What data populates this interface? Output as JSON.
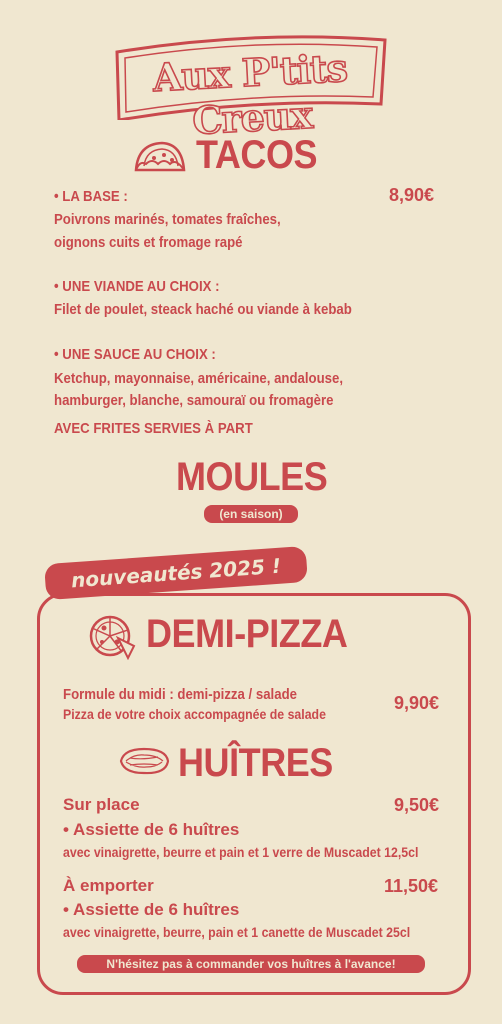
{
  "brand": {
    "name": "Aux P'tits Creux"
  },
  "tacos": {
    "title": "TACOS",
    "base_label": "• LA BASE :",
    "base_price": "8,90€",
    "base_line1": "Poivrons marinés, tomates fraîches,",
    "base_line2": "oignons cuits et fromage rapé",
    "viande_label": "• UNE VIANDE AU CHOIX :",
    "viande_line1": "Filet de poulet, steack haché ou viande à kebab",
    "sauce_label": "• UNE SAUCE AU CHOIX :",
    "sauce_line1": "Ketchup, mayonnaise, américaine, andalouse,",
    "sauce_line2": "hamburger, blanche, samouraï ou fromagère",
    "frites": "AVEC FRITES SERVIES À PART"
  },
  "moules": {
    "title": "MOULES",
    "note": "(en saison)"
  },
  "nouveautes": {
    "label": "nouveautés 2025 !"
  },
  "pizza": {
    "title": "DEMI-PIZZA",
    "line1": "Formule du midi : demi-pizza / salade",
    "line2": "Pizza de votre choix accompagnée de salade",
    "price": "9,90€"
  },
  "huitres": {
    "title": "HUÎTRES",
    "sur_place_label": "Sur place",
    "sur_place_price": "9,50€",
    "sur_place_item": "• Assiette de 6 huîtres",
    "sur_place_desc": "avec vinaigrette, beurre et pain et 1 verre de Muscadet 12,5cl",
    "emporter_label": "À emporter",
    "emporter_price": "11,50€",
    "emporter_item": "• Assiette de 6 huîtres",
    "emporter_desc": "avec vinaigrette, beurre, pain et 1 canette de Muscadet 25cl",
    "cta": "N'hésitez pas à commander vos huîtres à l'avance!"
  },
  "icons": {
    "taco": "taco-icon",
    "pizza": "pizza-icon",
    "oyster": "oyster-icon"
  },
  "colors": {
    "background": "#f0e7d0",
    "accent": "#c9494d"
  }
}
